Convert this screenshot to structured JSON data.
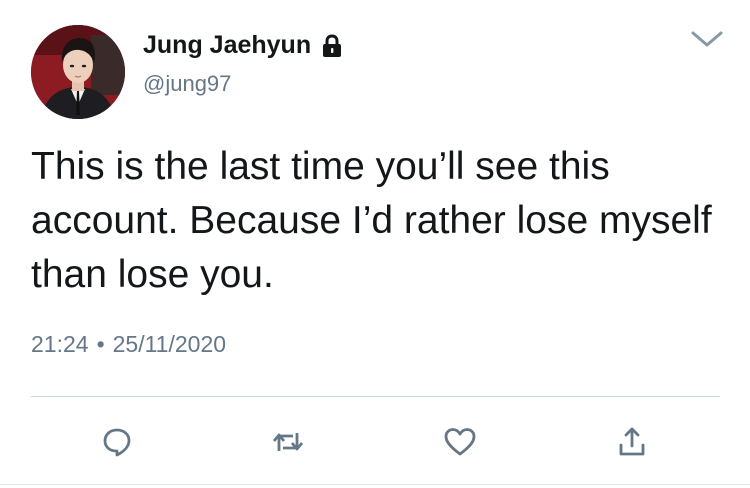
{
  "tweet": {
    "display_name": "Jung Jaehyun",
    "handle": "@jung97",
    "text": "This is the last time you’ll see this account. Because I’d rather lose myself than lose you.",
    "time": "21:24",
    "separator": "•",
    "date": "25/11/2020",
    "protected_icon": "lock-icon",
    "menu_icon": "chevron-down-icon"
  },
  "actions": {
    "reply_icon": "reply-icon",
    "retweet_icon": "retweet-icon",
    "like_icon": "heart-icon",
    "share_icon": "share-icon"
  },
  "colors": {
    "text": "#14171a",
    "secondary": "#657786",
    "icon": "#657786",
    "divider": "#ccd6dd"
  }
}
